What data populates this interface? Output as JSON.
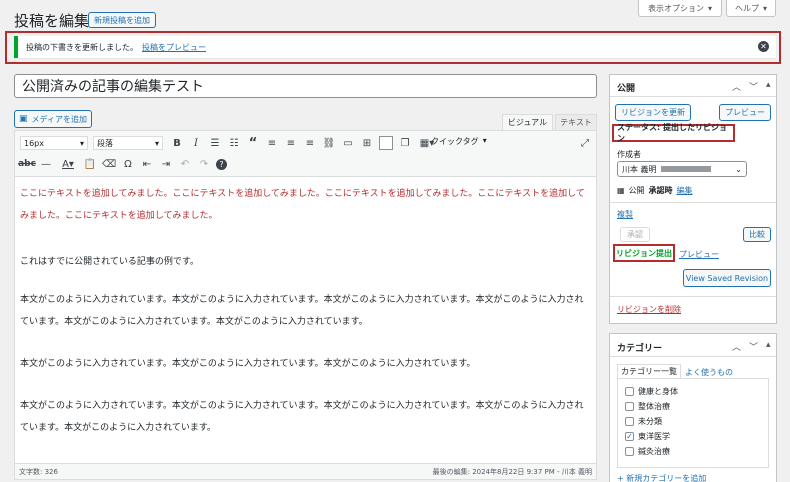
{
  "page": {
    "title": "投稿を編集",
    "add_new": "新規投稿を追加",
    "screen_options": "表示オプション",
    "help": "ヘルプ"
  },
  "notice": {
    "message": "投稿の下書きを更新しました。",
    "preview_link": "投稿をプレビュー"
  },
  "post": {
    "title": "公開済みの記事の編集テスト"
  },
  "editor": {
    "add_media": "メディアを追加",
    "tab_visual": "ビジュアル",
    "tab_text": "テキスト",
    "font_size": "16px",
    "format": "段落",
    "quicktag": "クイックタグ",
    "paragraphs": [
      "ここにテキストを追加してみました。ここにテキストを追加してみました。ここにテキストを追加してみました。ここにテキストを追加してみました。ここにテキストを追加してみました。",
      "これはすでに公開されている記事の例です。",
      "本文がこのように入力されています。本文がこのように入力されています。本文がこのように入力されています。本文がこのように入力されています。本文がこのように入力されています。本文がこのように入力されています。",
      "本文がこのように入力されています。本文がこのように入力されています。本文がこのように入力されています。",
      "本文がこのように入力されています。本文がこのように入力されています。本文がこのように入力されています。本文がこのように入力されています。本文がこのように入力されています。"
    ],
    "word_count": "文字数: 326",
    "last_edit": "最後の編集: 2024年8月22日 9:37 PM - 川本 義明"
  },
  "publish": {
    "heading": "公開",
    "update_revision": "リビジョンを更新",
    "preview": "プレビュー",
    "status": "ステータス: 提出したリビジョン",
    "author_label": "作成者",
    "author_value": "川本 義明",
    "visibility_label": "公開",
    "visibility_value": "承認時",
    "edit": "編集",
    "duplicate": "複製",
    "approve": "承認",
    "compare": "比較",
    "submit_revision": "リビジョン提出",
    "preview_link": "プレビュー",
    "view_saved": "View Saved Revision",
    "delete_revision": "リビジョンを削除"
  },
  "category": {
    "heading": "カテゴリー",
    "tab_all": "カテゴリー一覧",
    "tab_popular": "よく使うもの",
    "items": [
      {
        "label": "健康と身体",
        "checked": false
      },
      {
        "label": "整体治療",
        "checked": false
      },
      {
        "label": "未分類",
        "checked": false
      },
      {
        "label": "東洋医学",
        "checked": true
      },
      {
        "label": "鍼灸治療",
        "checked": false
      }
    ],
    "add_new": "+ 新規カテゴリーを追加"
  },
  "colors": {
    "accent": "#2271b1",
    "highlight_border": "#b32d2e",
    "notice_success": "#00a32a"
  }
}
